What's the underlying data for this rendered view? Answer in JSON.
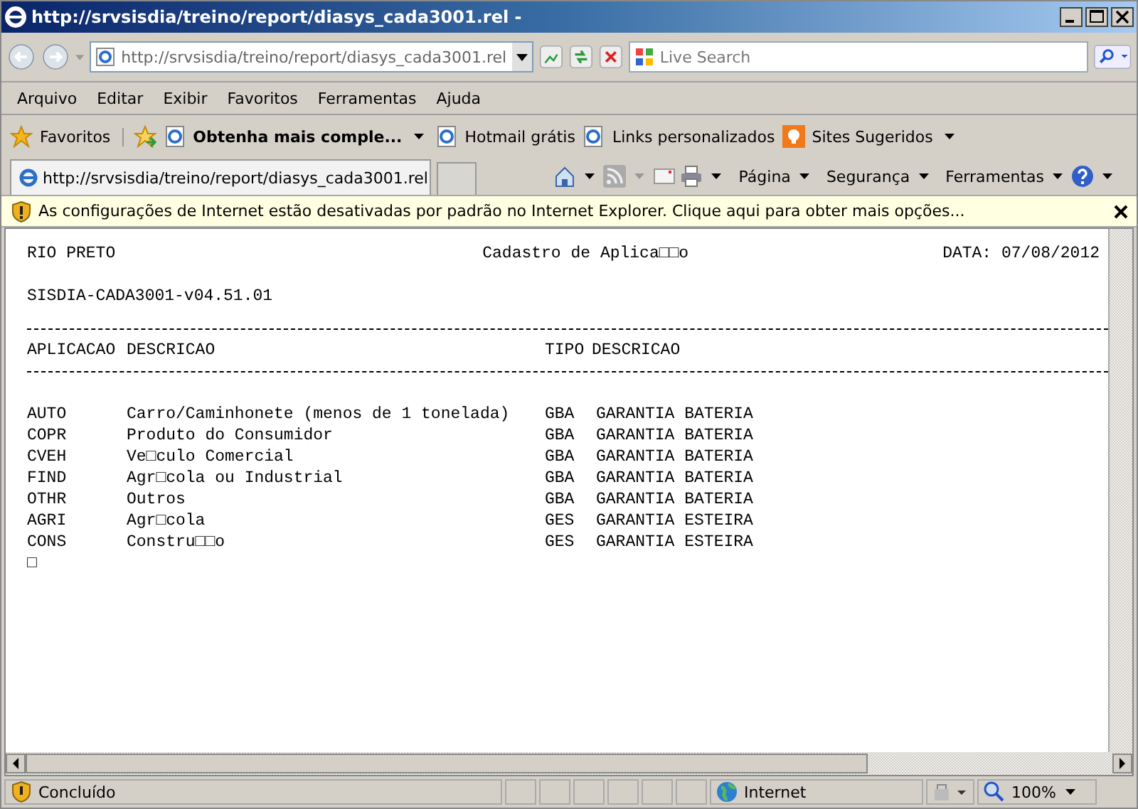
{
  "window": {
    "title": "http://srvsisdia/treino/report/diasys_cada3001.rel -"
  },
  "nav": {
    "address": "http://srvsisdia/treino/report/diasys_cada3001.rel",
    "search": {
      "placeholder": "Live Search"
    }
  },
  "menu": [
    "Arquivo",
    "Editar",
    "Exibir",
    "Favoritos",
    "Ferramentas",
    "Ajuda"
  ],
  "favorites_bar": {
    "label": "Favoritos",
    "items": [
      {
        "label": "Obtenha mais comple...",
        "kind": "feed"
      },
      {
        "label": "Hotmail grátis",
        "kind": "link"
      },
      {
        "label": "Links personalizados",
        "kind": "link"
      },
      {
        "label": "Sites Sugeridos",
        "kind": "suggested"
      }
    ]
  },
  "tab": {
    "title": "http://srvsisdia/treino/report/diasys_cada3001.rel"
  },
  "command_bar": [
    "Página",
    "Segurança",
    "Ferramentas"
  ],
  "info_bar": {
    "text": "As configurações de Internet estão desativadas por padrão no Internet Explorer. Clique aqui para obter mais opções..."
  },
  "report": {
    "location": "RIO PRETO",
    "title": "Cadastro de Aplica□□o",
    "date": "DATA: 07/08/2012",
    "version": "SISDIA-CADA3001-v04.51.01",
    "columns": [
      "APLICACAO",
      "DESCRICAO",
      "TIPO",
      "DESCRICAO"
    ],
    "rows": [
      {
        "code": "AUTO",
        "description": "Carro/Caminhonete (menos de 1 tonelada)",
        "type": "GBA",
        "type_description": "GARANTIA BATERIA"
      },
      {
        "code": "COPR",
        "description": "Produto do Consumidor",
        "type": "GBA",
        "type_description": "GARANTIA BATERIA"
      },
      {
        "code": "CVEH",
        "description": "Ve□culo Comercial",
        "type": "GBA",
        "type_description": "GARANTIA BATERIA"
      },
      {
        "code": "FIND",
        "description": "Agr□cola ou Industrial",
        "type": "GBA",
        "type_description": "GARANTIA BATERIA"
      },
      {
        "code": "OTHR",
        "description": "Outros",
        "type": "GBA",
        "type_description": "GARANTIA BATERIA"
      },
      {
        "code": "AGRI",
        "description": "Agr□cola",
        "type": "GES",
        "type_description": "GARANTIA ESTEIRA"
      },
      {
        "code": "CONS",
        "description": "Constru□□o",
        "type": "GES",
        "type_description": "GARANTIA ESTEIRA"
      }
    ],
    "trailer": "□"
  },
  "status_bar": {
    "text": "Concluído",
    "zone": "Internet",
    "zoom": "100%"
  }
}
